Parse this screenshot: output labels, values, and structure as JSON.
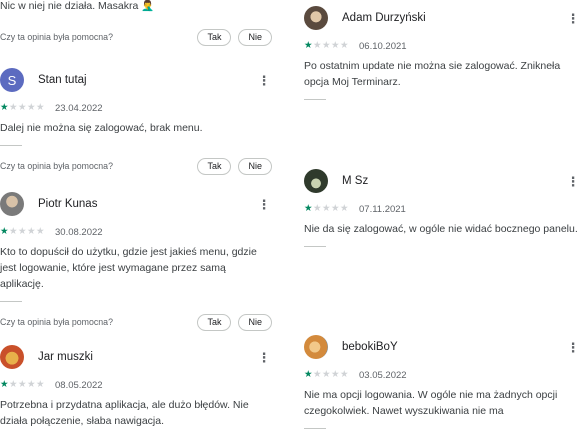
{
  "left_column": {
    "top_fragment": {
      "text": "Nic w niej nie działa. Masakra 🤦‍♂️",
      "helpful_question": "Czy ta opinia była pomocna?",
      "yes": "Tak",
      "no": "Nie"
    },
    "reviews": [
      {
        "author": "Stan tutaj",
        "avatar_letter": "S",
        "avatar_color": "#5c6bc0",
        "stars": 1,
        "date": "23.04.2022",
        "text": "Dalej nie można się zalogować, brak menu.",
        "helpful_question": "Czy ta opinia była pomocna?",
        "yes": "Tak",
        "no": "Nie"
      },
      {
        "author": "Piotr Kunas",
        "avatar_color": "#8d8d8d",
        "stars": 1,
        "date": "30.08.2022",
        "text": "Kto to dopuścił do użytku, gdzie jest jakieś menu, gdzie jest logowanie, które jest wymagane przez samą aplikację.",
        "helpful_question": "Czy ta opinia była pomocna?",
        "yes": "Tak",
        "no": "Nie"
      },
      {
        "author": "Jar muszki",
        "avatar_color": "#c9502a",
        "stars": 1,
        "date": "08.05.2022",
        "text": "Potrzebna i przydatna aplikacja, ale dużo błędów. Nie działa połączenie, słaba nawigacja."
      }
    ]
  },
  "right_column": {
    "reviews": [
      {
        "author": "Adam Durzyński",
        "avatar_color": "#6d5a4a",
        "stars": 1,
        "date": "06.10.2021",
        "text": "Po ostatnim update nie można sie zalogować. Znikneła opcja Moj Terminarz."
      },
      {
        "author": "M Sz",
        "avatar_color": "#3d4a3a",
        "stars": 1,
        "date": "07.11.2021",
        "text": "Nie da się zalogować, w ogóle nie widać bocznego panelu."
      },
      {
        "author": "bebokiBoY",
        "avatar_color": "#d38a3c",
        "stars": 1,
        "date": "03.05.2022",
        "text": "Nie ma opcji logowania. W ogóle nie ma żadnych opcji czegokolwiek. Nawet wyszukiwania nie ma"
      }
    ]
  },
  "icons": {
    "more": "more-vert-icon",
    "star": "star-icon"
  },
  "colors": {
    "star_filled": "#01875f",
    "star_empty": "#d0d3d6"
  }
}
